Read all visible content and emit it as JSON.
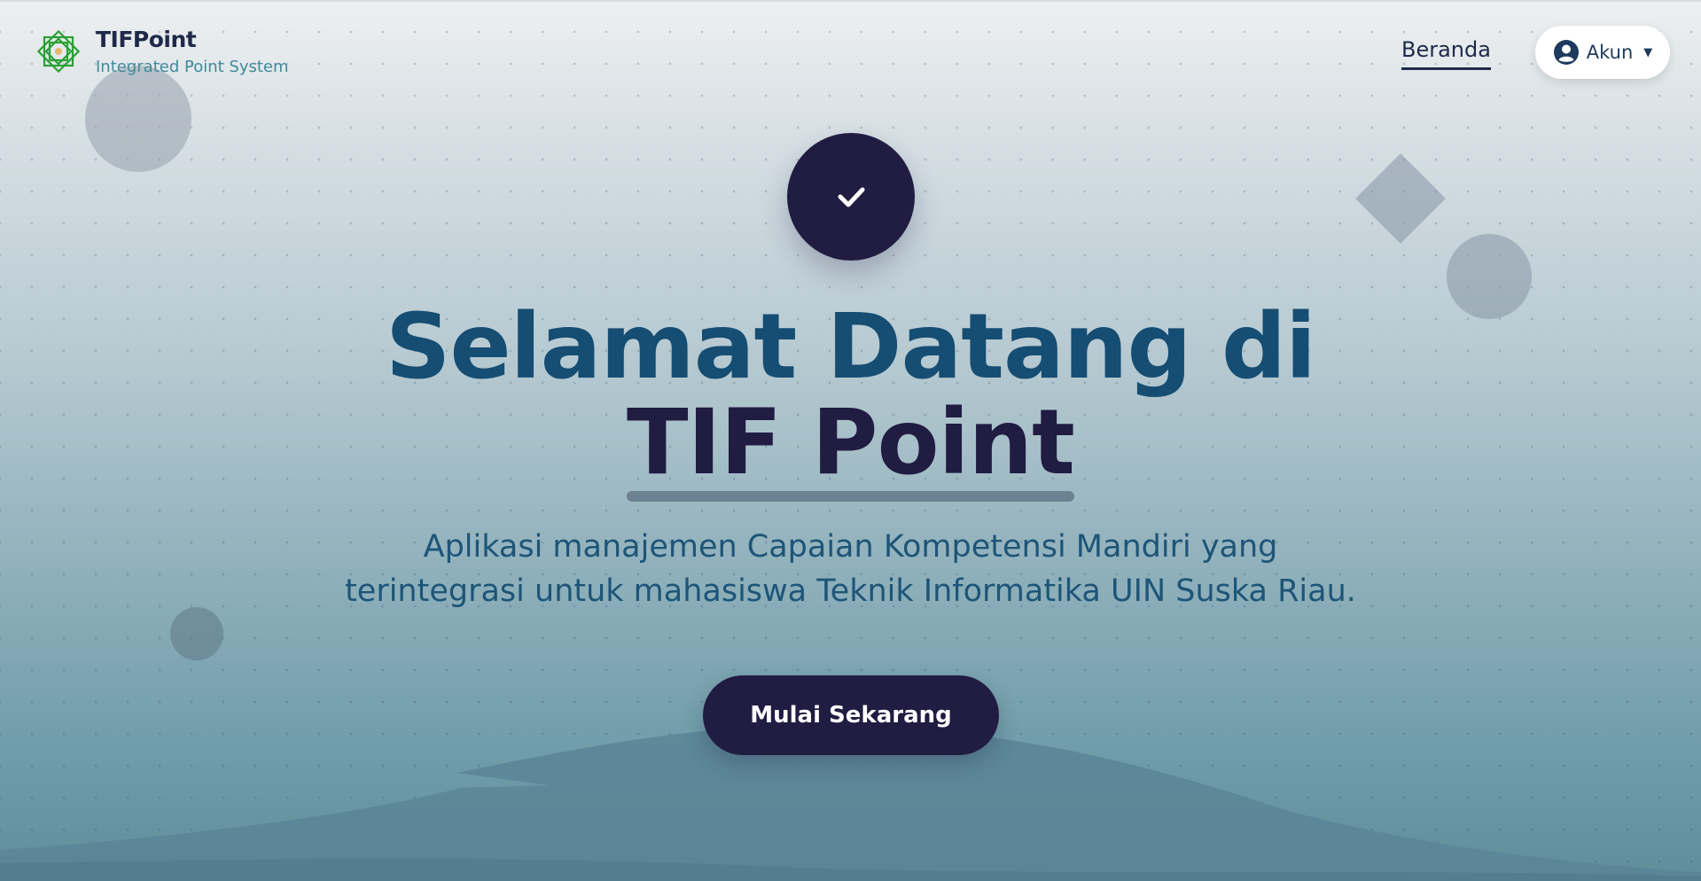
{
  "header": {
    "brand_name": "TIFPoint",
    "brand_subtitle": "Integrated Point System",
    "nav_home": "Beranda",
    "account_label": "Akun",
    "account_caret": "▼"
  },
  "hero": {
    "title_line1": "Selamat Datang di",
    "title_line2": "TIF Point",
    "description_line1": "Aplikasi manajemen Capaian Kompetensi Mandiri yang",
    "description_line2": "terintegrasi untuk mahasiswa Teknik Informatika UIN Suska Riau.",
    "cta_label": "Mulai Sekarang"
  },
  "icons": {
    "logo": "octagram-logo-icon",
    "account": "user-circle-icon",
    "hero_badge": "check-icon"
  },
  "colors": {
    "primary_dark": "#211c42",
    "title_blue": "#154d73",
    "logo_green": "#2aa035",
    "subtitle_teal": "#3f8a99"
  }
}
